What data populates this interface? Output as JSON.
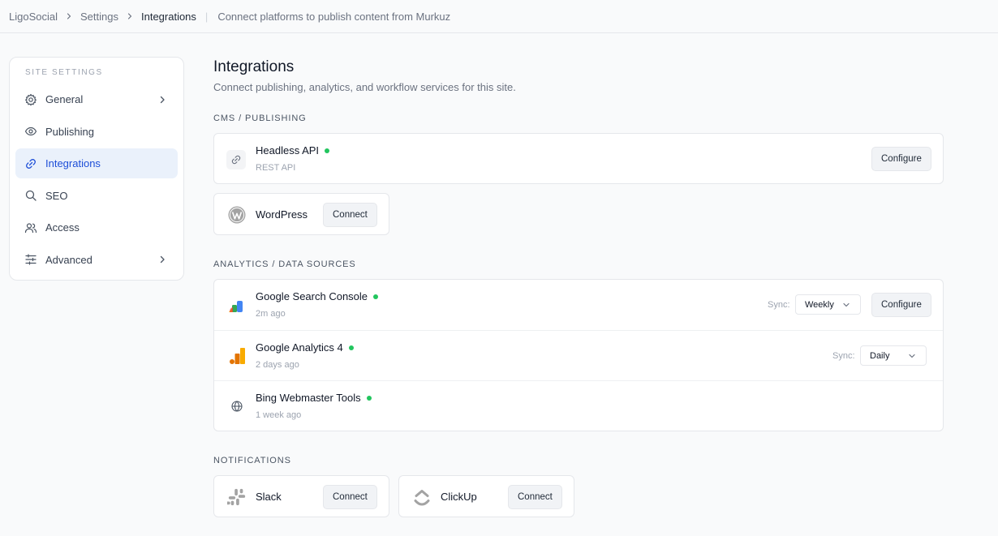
{
  "breadcrumb": {
    "items": [
      "LigoSocial",
      "Settings",
      "Integrations"
    ],
    "subtitle": "Connect platforms to publish content from Murkuz"
  },
  "sidebar": {
    "section_label": "SITE SETTINGS",
    "items": [
      {
        "label": "General",
        "icon": "gear-icon",
        "has_chevron": true,
        "active": false
      },
      {
        "label": "Publishing",
        "icon": "eye-icon",
        "has_chevron": false,
        "active": false
      },
      {
        "label": "Integrations",
        "icon": "link-icon",
        "has_chevron": false,
        "active": true
      },
      {
        "label": "SEO",
        "icon": "search-icon",
        "has_chevron": false,
        "active": false
      },
      {
        "label": "Access",
        "icon": "users-icon",
        "has_chevron": false,
        "active": false
      },
      {
        "label": "Advanced",
        "icon": "sliders-icon",
        "has_chevron": true,
        "active": false
      }
    ]
  },
  "main": {
    "title": "Integrations",
    "description": "Connect publishing, analytics, and workflow services for this site.",
    "sections": {
      "cms": {
        "heading": "CMS / PUBLISHING",
        "headless": {
          "name": "Headless API",
          "subtitle": "REST API",
          "status": "connected",
          "button": "Configure",
          "icon": "link-icon"
        },
        "wordpress": {
          "name": "WordPress",
          "button": "Connect",
          "icon": "wordpress-icon"
        }
      },
      "analytics": {
        "heading": "ANALYTICS / DATA SOURCES",
        "sync_label": "Sync:",
        "items": [
          {
            "name": "Google Search Console",
            "subtitle": "2m ago",
            "status": "connected",
            "sync_value": "Weekly",
            "button": "Configure",
            "icon": "google-search-console-icon"
          },
          {
            "name": "Google Analytics 4",
            "subtitle": "2 days ago",
            "status": "connected",
            "sync_value": "Daily",
            "icon": "google-analytics-icon"
          },
          {
            "name": "Bing Webmaster Tools",
            "subtitle": "1 week ago",
            "status": "connected",
            "icon": "globe-icon"
          }
        ]
      },
      "notifications": {
        "heading": "NOTIFICATIONS",
        "items": [
          {
            "name": "Slack",
            "button": "Connect",
            "icon": "slack-icon"
          },
          {
            "name": "ClickUp",
            "button": "Connect",
            "icon": "clickup-icon"
          }
        ]
      }
    }
  },
  "colors": {
    "accent": "#1d4ed8",
    "active_bg": "#eaf1fb",
    "status_green": "#22c55e",
    "border": "#e5e7eb",
    "background": "#f9fafb"
  }
}
